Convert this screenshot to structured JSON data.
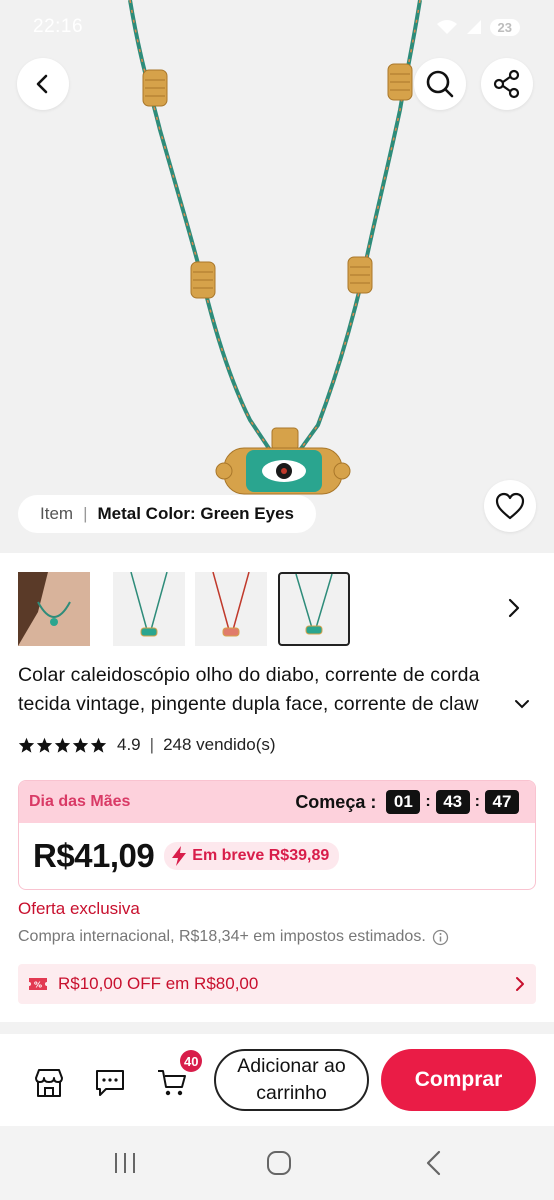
{
  "status_bar": {
    "time": "22:16",
    "battery": "23"
  },
  "product": {
    "variant_label": "Item",
    "variant_separator": "|",
    "variant_value": "Metal Color: Green Eyes",
    "title": "Colar caleidoscópio olho do diabo, corrente de corda tecida vintage, pingente dupla face, corrente de claw",
    "rating": "4.9",
    "rating_separator": "|",
    "sold": "248 vendido(s)",
    "stars": 5
  },
  "promo": {
    "name": "Dia das Mães",
    "starts_label": "Começa :",
    "countdown": [
      "01",
      "43",
      "47"
    ],
    "countdown_sep": ":",
    "price": "R$41,09",
    "soon_text": "Em breve R$39,89"
  },
  "exclusive_offer": "Oferta exclusiva",
  "tax_note": "Compra internacional, R$18,34+ em impostos estimados.",
  "coupon": {
    "text": "R$10,00 OFF em R$80,00"
  },
  "bottom_bar": {
    "cart_count": "40",
    "add_to_cart": "Adicionar ao carrinho",
    "buy": "Comprar"
  },
  "colors": {
    "accent": "#ea1c46",
    "promo_bg": "#fdd1dc",
    "promo_text": "#d93a66",
    "cord_green": "#2e8c7a",
    "gold": "#d6a24a"
  },
  "icons": [
    "back-arrow-icon",
    "search-icon",
    "share-icon",
    "heart-icon",
    "chevron-right-icon",
    "chevron-down-icon",
    "star-icon",
    "lightning-icon",
    "info-icon",
    "coupon-icon",
    "store-icon",
    "chat-icon",
    "cart-icon",
    "recents-icon",
    "home-icon",
    "back-icon"
  ]
}
